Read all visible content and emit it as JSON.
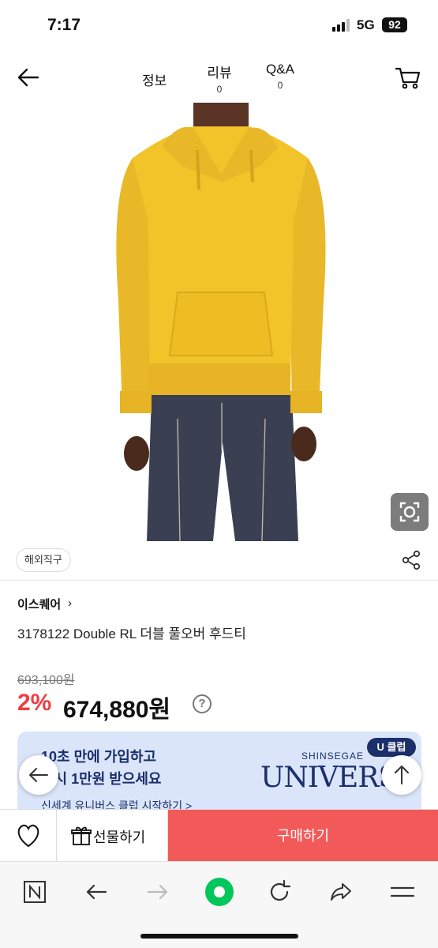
{
  "status": {
    "time": "7:17",
    "network": "5G",
    "battery": "92"
  },
  "header": {
    "tabs": [
      {
        "label": "정보"
      },
      {
        "label": "리뷰",
        "count": "0"
      },
      {
        "label": "Q&A",
        "count": "0"
      }
    ]
  },
  "product": {
    "tag": "해외직구",
    "brand": "이스퀘어",
    "title": "3178122 Double RL 더블 풀오버 후드티",
    "original_price": "693,100원",
    "discount": "2%",
    "price": "674,880원",
    "help": "?"
  },
  "banner": {
    "line1": "10초 만에 가입하고",
    "line2": "즉시 1만원 받으세요",
    "link": "신세계 유니버스 클럽 시작하기 >",
    "brand_small": "SHINSEGAE",
    "brand_large": "UNIVERSE",
    "badge": "U 클럽"
  },
  "buybar": {
    "gift_label": "선물하기",
    "buy_label": "구매하기"
  },
  "colors": {
    "accent": "#ef3e42",
    "buy_bg": "#f25a5a",
    "hoodie": "#f2c42a",
    "banner_bg": "#dbe5fa",
    "navy": "#1b2f6b"
  },
  "icons": [
    "back-arrow-icon",
    "cart-icon",
    "visual-search-icon",
    "share-icon",
    "chevron-right-icon",
    "help-icon",
    "heart-icon",
    "gift-icon",
    "prev-arrow-icon",
    "up-arrow-icon",
    "naver-n-icon",
    "browser-back-icon",
    "browser-forward-icon",
    "green-dot-icon",
    "reload-icon",
    "browser-share-icon",
    "menu-icon"
  ]
}
